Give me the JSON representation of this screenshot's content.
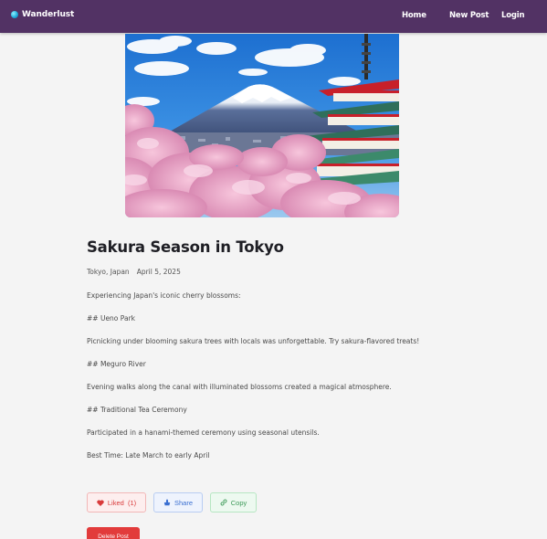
{
  "navbar": {
    "brand": "Wanderlust",
    "links": {
      "home": "Home",
      "new_post": "New Post",
      "login": "Login"
    }
  },
  "hero": {
    "alt_icon": "photo"
  },
  "post": {
    "title": "Sakura Season in Tokyo",
    "location": "Tokyo, Japan",
    "date": "April 5, 2025",
    "paragraphs": [
      "Experiencing Japan's iconic cherry blossoms:",
      "## Ueno Park",
      "Picnicking under blooming sakura trees with locals was unforgettable. Try sakura-flavored treats!",
      "## Meguro River",
      "Evening walks along the canal with illuminated blossoms created a magical atmosphere.",
      "## Traditional Tea Ceremony",
      "Participated in a hanami-themed ceremony using seasonal utensils.",
      "Best Time: Late March to early April"
    ]
  },
  "actions": {
    "like_label": "Liked",
    "like_count": "(1)",
    "share_label": "Share",
    "copy_label": "Copy",
    "delete_label": "Delete Post"
  },
  "colors": {
    "navbar": "#523264",
    "like": "#d93b3b",
    "share": "#3a6fd1",
    "copy": "#3c9a58",
    "delete": "#e23b3b"
  }
}
